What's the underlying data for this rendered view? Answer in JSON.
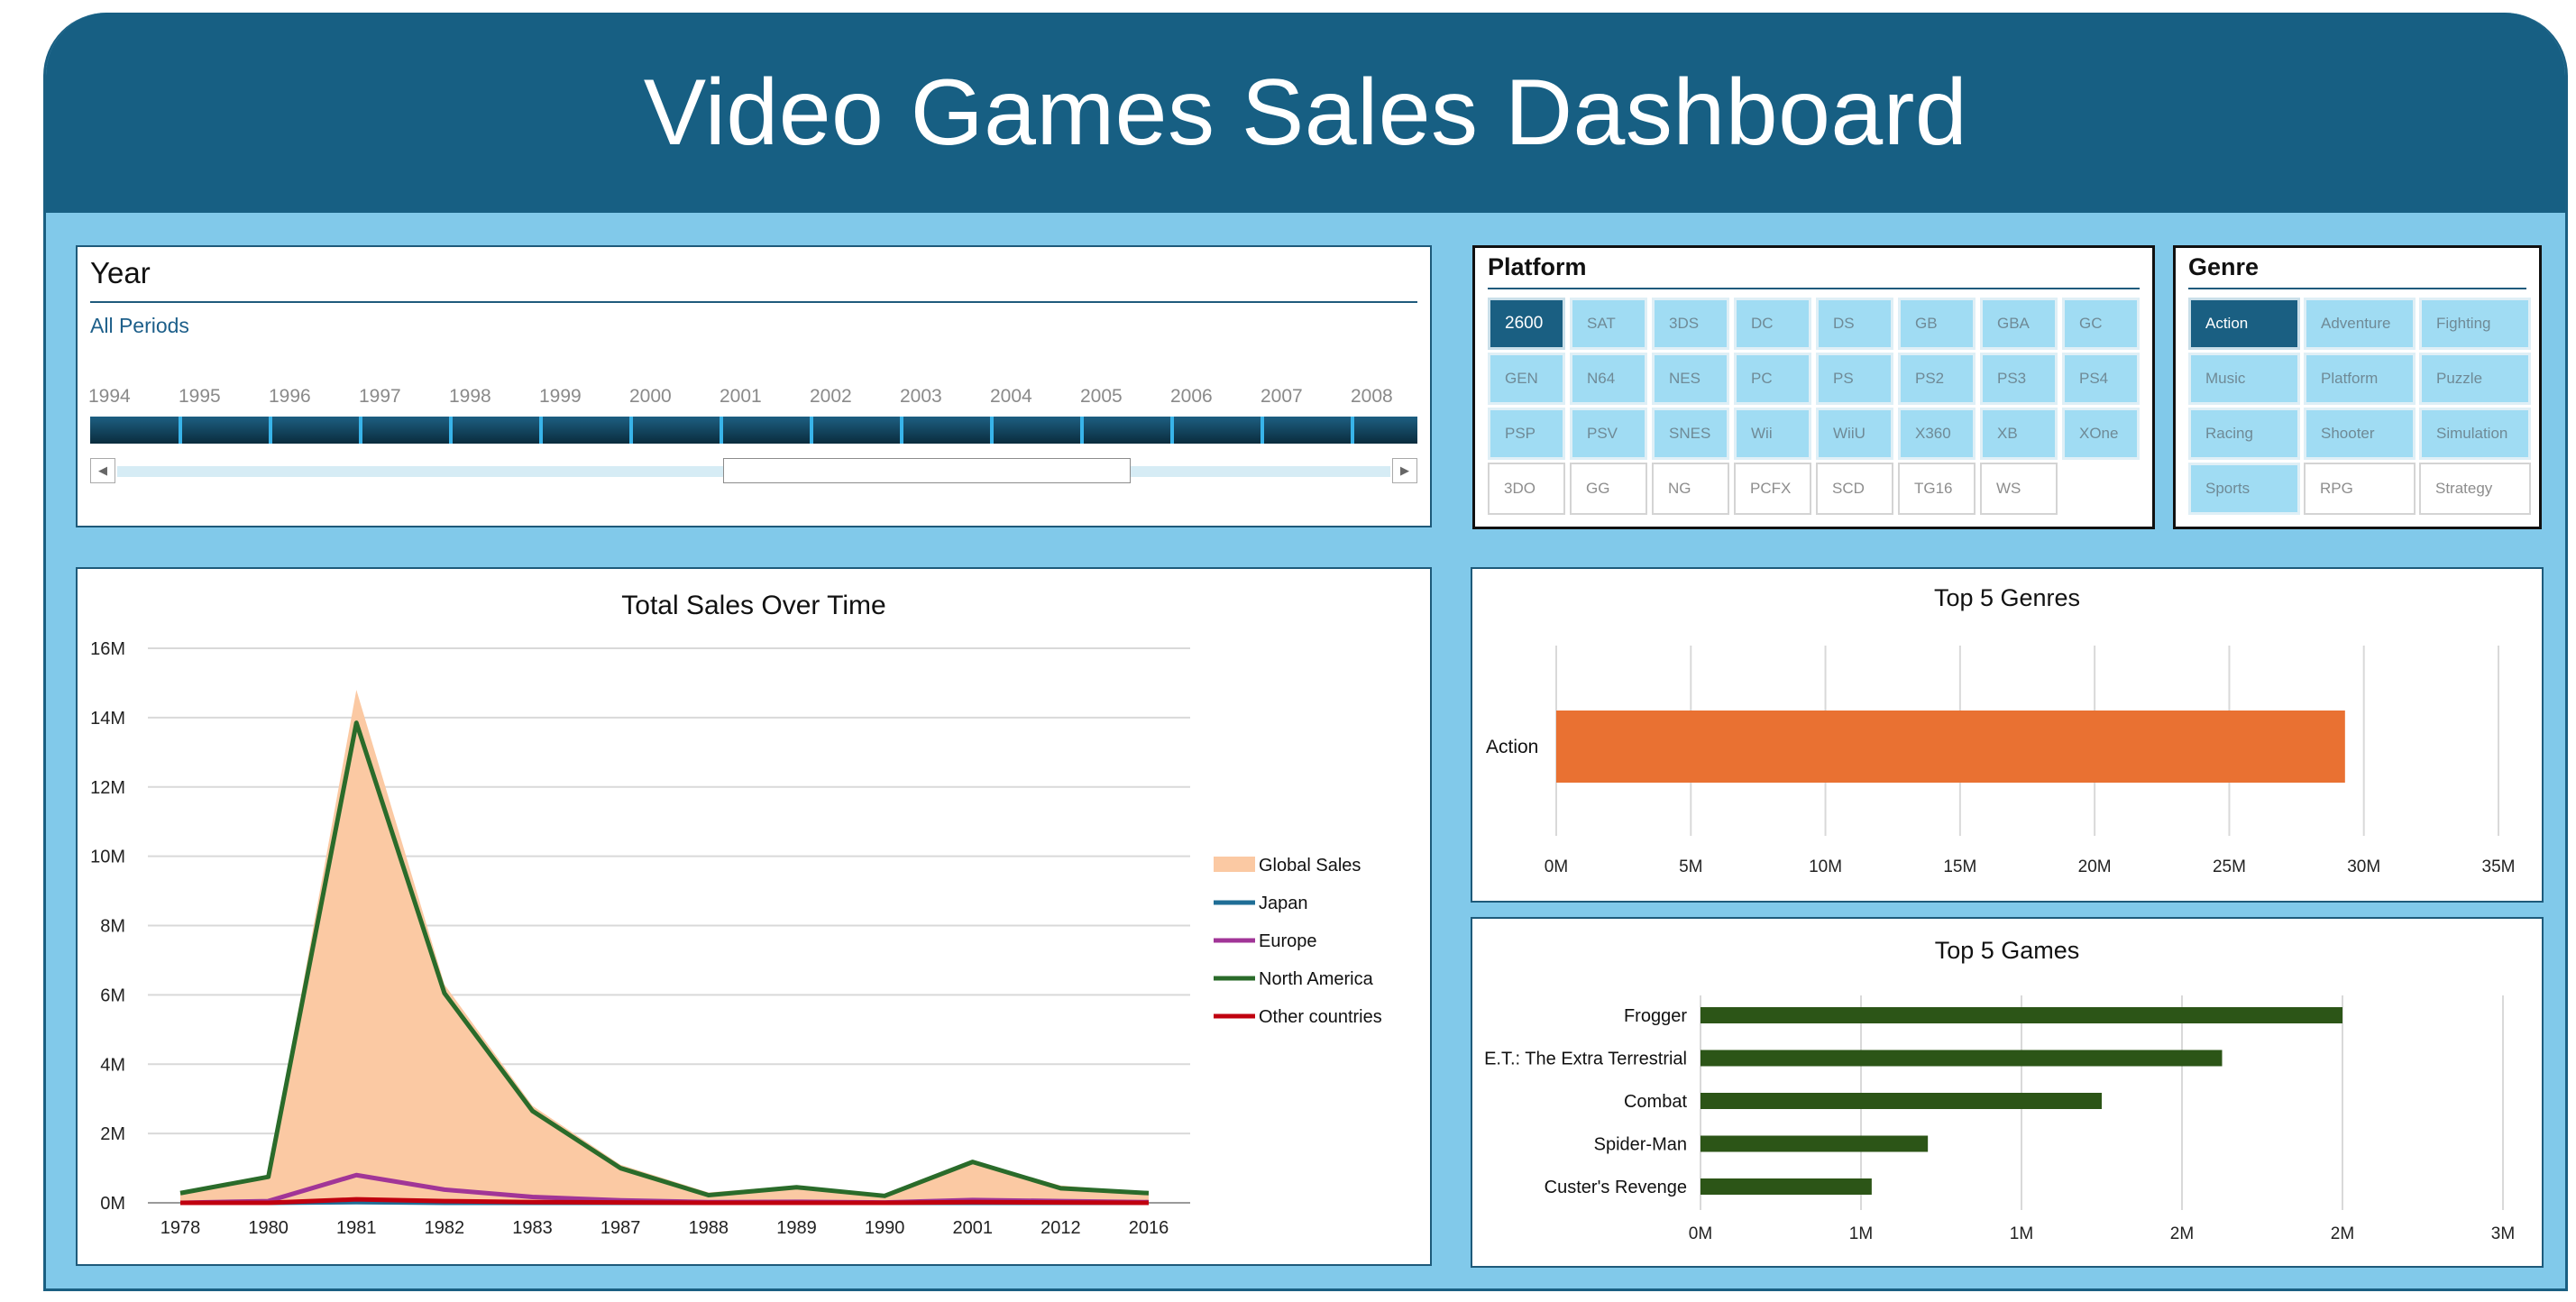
{
  "dashboard": {
    "title": "Video Games Sales Dashboard"
  },
  "year_slicer": {
    "title": "Year",
    "status": "All Periods",
    "years": [
      "1994",
      "1995",
      "1996",
      "1997",
      "1998",
      "1999",
      "2000",
      "2001",
      "2002",
      "2003",
      "2004",
      "2005",
      "2006",
      "2007",
      "2008"
    ],
    "scroll_left": "◀",
    "scroll_right": "▶"
  },
  "platform_slicer": {
    "title": "Platform",
    "items": [
      {
        "label": "2600",
        "state": "selected"
      },
      {
        "label": "SAT",
        "state": "available"
      },
      {
        "label": "3DS",
        "state": "available"
      },
      {
        "label": "DC",
        "state": "available"
      },
      {
        "label": "DS",
        "state": "available"
      },
      {
        "label": "GB",
        "state": "available"
      },
      {
        "label": "GBA",
        "state": "available"
      },
      {
        "label": "GC",
        "state": "available"
      },
      {
        "label": "GEN",
        "state": "available"
      },
      {
        "label": "N64",
        "state": "available"
      },
      {
        "label": "NES",
        "state": "available"
      },
      {
        "label": "PC",
        "state": "available"
      },
      {
        "label": "PS",
        "state": "available"
      },
      {
        "label": "PS2",
        "state": "available"
      },
      {
        "label": "PS3",
        "state": "available"
      },
      {
        "label": "PS4",
        "state": "available"
      },
      {
        "label": "PSP",
        "state": "available"
      },
      {
        "label": "PSV",
        "state": "available"
      },
      {
        "label": "SNES",
        "state": "available"
      },
      {
        "label": "Wii",
        "state": "available"
      },
      {
        "label": "WiiU",
        "state": "available"
      },
      {
        "label": "X360",
        "state": "available"
      },
      {
        "label": "XB",
        "state": "available"
      },
      {
        "label": "XOne",
        "state": "available"
      },
      {
        "label": "3DO",
        "state": "nodata"
      },
      {
        "label": "GG",
        "state": "nodata"
      },
      {
        "label": "NG",
        "state": "nodata"
      },
      {
        "label": "PCFX",
        "state": "nodata"
      },
      {
        "label": "SCD",
        "state": "nodata"
      },
      {
        "label": "TG16",
        "state": "nodata"
      },
      {
        "label": "WS",
        "state": "nodata"
      }
    ]
  },
  "genre_slicer": {
    "title": "Genre",
    "items": [
      {
        "label": "Action",
        "state": "selected"
      },
      {
        "label": "Adventure",
        "state": "available"
      },
      {
        "label": "Fighting",
        "state": "available"
      },
      {
        "label": "Music",
        "state": "available"
      },
      {
        "label": "Platform",
        "state": "available"
      },
      {
        "label": "Puzzle",
        "state": "available"
      },
      {
        "label": "Racing",
        "state": "available"
      },
      {
        "label": "Shooter",
        "state": "available"
      },
      {
        "label": "Simulation",
        "state": "available"
      },
      {
        "label": "Sports",
        "state": "available"
      },
      {
        "label": "RPG",
        "state": "nodata"
      },
      {
        "label": "Strategy",
        "state": "nodata"
      }
    ]
  },
  "colors": {
    "header": "#175f83",
    "background": "#81c9ea",
    "global_sales": "#fbc9a3",
    "japan": "#1f6e96",
    "europe": "#a13597",
    "north_america": "#2a6b2a",
    "other": "#c0000f",
    "top_genres_bar": "#e97132",
    "top_games_bar": "#2c5517"
  },
  "chart_data": [
    {
      "type": "area",
      "title": "Total Sales Over Time",
      "categories": [
        "1978",
        "1980",
        "1981",
        "1982",
        "1983",
        "1987",
        "1988",
        "1989",
        "1990",
        "2001",
        "2012",
        "2016"
      ],
      "yticks": [
        "0M",
        "2M",
        "4M",
        "6M",
        "8M",
        "10M",
        "12M",
        "14M",
        "16M"
      ],
      "ylim": [
        0,
        16
      ],
      "grid": true,
      "legend_position": "right",
      "series": [
        {
          "name": "Global Sales",
          "kind": "area",
          "values": [
            0.3,
            0.8,
            14.8,
            6.3,
            2.8,
            1.1,
            0.3,
            0.5,
            0.2,
            1.2,
            0.5,
            0.3
          ]
        },
        {
          "name": "Japan",
          "kind": "line",
          "values": [
            0,
            0,
            0.02,
            0,
            0,
            0,
            0,
            0,
            0,
            0,
            0,
            0
          ]
        },
        {
          "name": "Europe",
          "kind": "line",
          "values": [
            0,
            0.05,
            0.8,
            0.38,
            0.17,
            0.07,
            0.02,
            0.03,
            0.01,
            0.08,
            0.05,
            0.02
          ]
        },
        {
          "name": "North America",
          "kind": "line",
          "values": [
            0.28,
            0.75,
            13.85,
            6.05,
            2.65,
            1.0,
            0.22,
            0.45,
            0.2,
            1.18,
            0.42,
            0.28
          ]
        },
        {
          "name": "Other countries",
          "kind": "line",
          "values": [
            0,
            0,
            0.1,
            0.05,
            0.02,
            0.01,
            0,
            0,
            0,
            0.02,
            0.01,
            0
          ]
        }
      ]
    },
    {
      "type": "bar",
      "orientation": "horizontal",
      "title": "Top 5 Genres",
      "categories": [
        "Action"
      ],
      "values": [
        29.3
      ],
      "xticks": [
        "0M",
        "5M",
        "10M",
        "15M",
        "20M",
        "25M",
        "30M",
        "35M"
      ],
      "xlim": [
        0,
        35
      ],
      "grid": true
    },
    {
      "type": "bar",
      "orientation": "horizontal",
      "title": "Top 5 Games",
      "categories": [
        "Frogger",
        "E.T.: The Extra Terrestrial",
        "Combat",
        "Spider-Man",
        "Custer's Revenge"
      ],
      "values": [
        2.4,
        1.95,
        1.5,
        0.85,
        0.64
      ],
      "xticks": [
        "0M",
        "1M",
        "1M",
        "2M",
        "2M",
        "3M"
      ],
      "xlim": [
        0,
        3
      ],
      "grid": true
    }
  ]
}
